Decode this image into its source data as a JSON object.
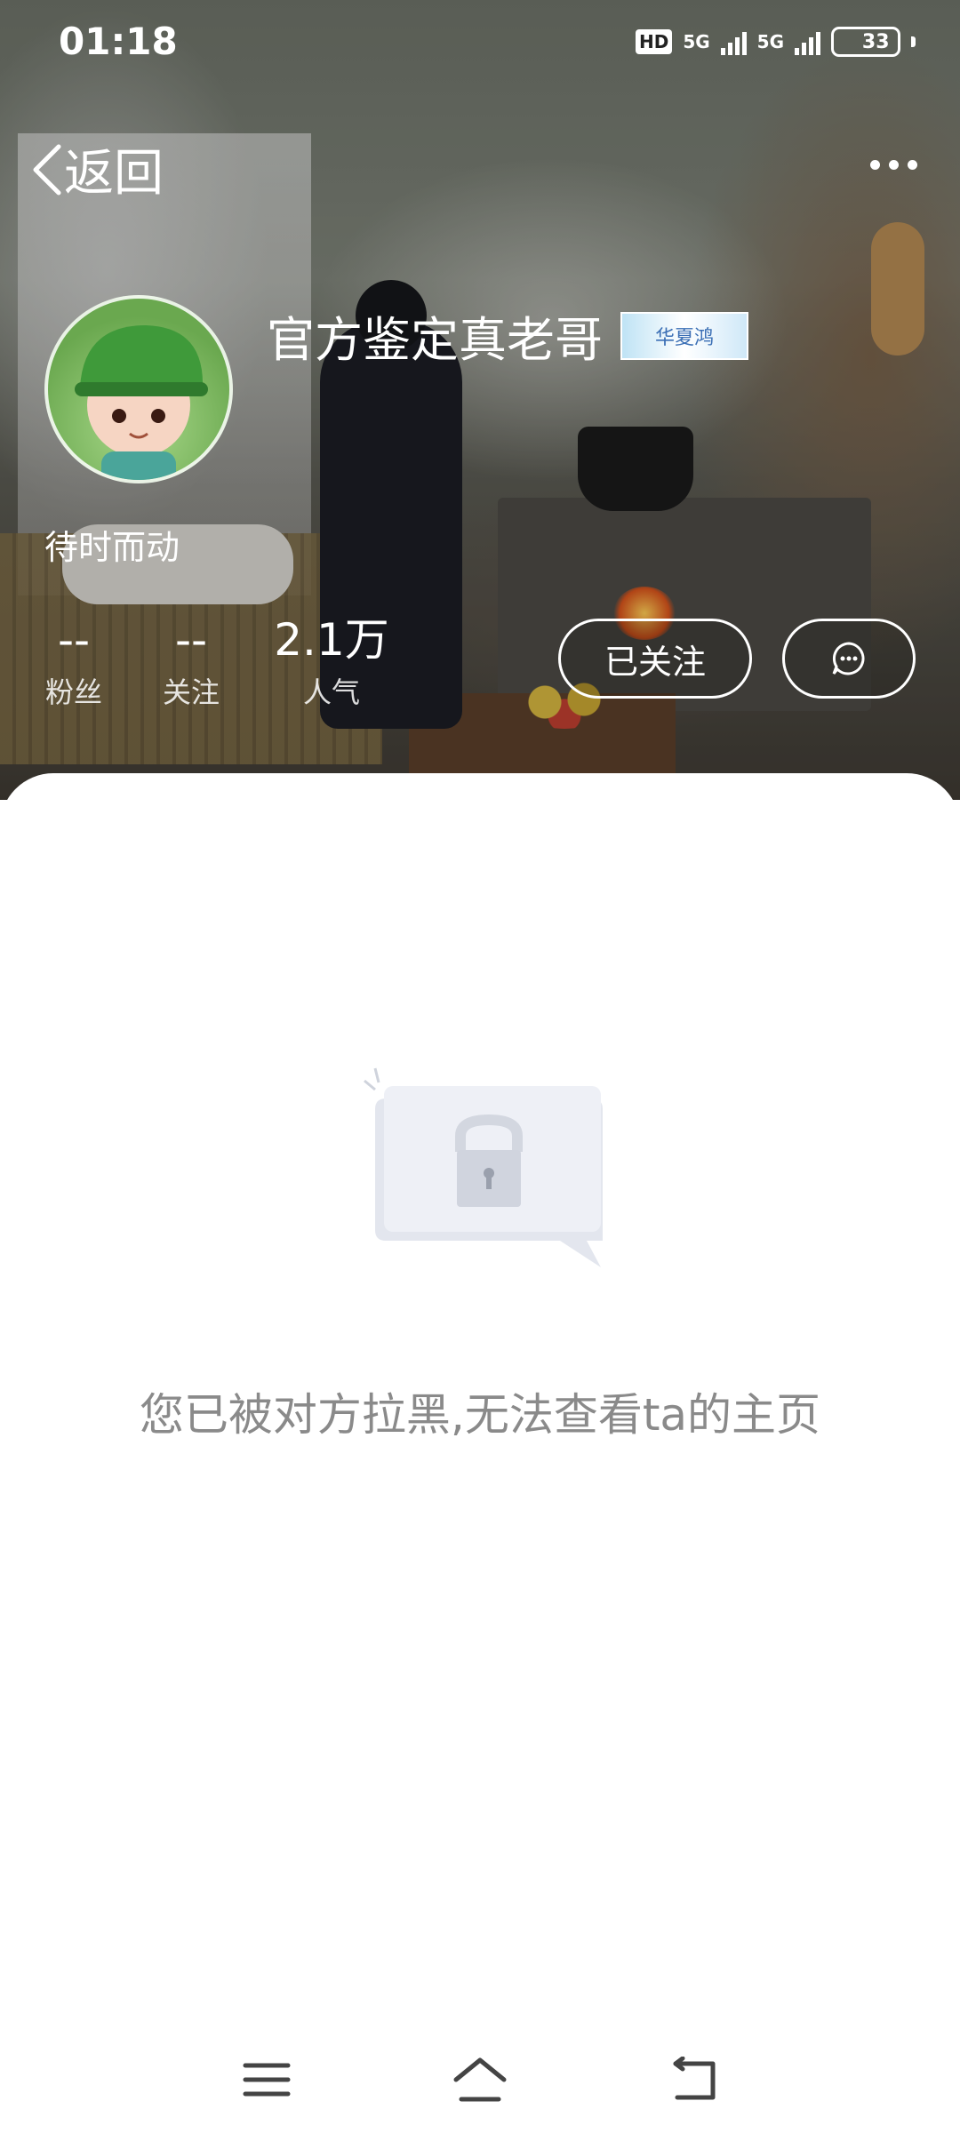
{
  "status_bar": {
    "time": "01:18",
    "hd_label": "HD",
    "network_1": "5G",
    "network_2": "5G",
    "battery": "33",
    "battery_level_percent": 33
  },
  "header": {
    "back_label": "返回",
    "more_icon": "more-dots-icon"
  },
  "profile": {
    "name": "官方鉴定真老哥",
    "badge_text": "华夏鸿",
    "bio": "待时而动",
    "stats": [
      {
        "value": "--",
        "label": "粉丝"
      },
      {
        "value": "--",
        "label": "关注"
      },
      {
        "value": "2.1万",
        "label": "人气"
      }
    ],
    "follow_label": "已关注",
    "message_icon": "chat-bubble-icon"
  },
  "blocked": {
    "message": "您已被对方拉黑,无法查看ta的主页",
    "icon": "lock-chat-icon"
  },
  "nav_bar": {
    "menu_icon": "menu-icon",
    "home_icon": "home-icon",
    "back_icon": "back-icon"
  },
  "colors": {
    "hint_text": "#8a8a8a",
    "battery": "#32a0f0",
    "page_bg": "#ffffff"
  }
}
